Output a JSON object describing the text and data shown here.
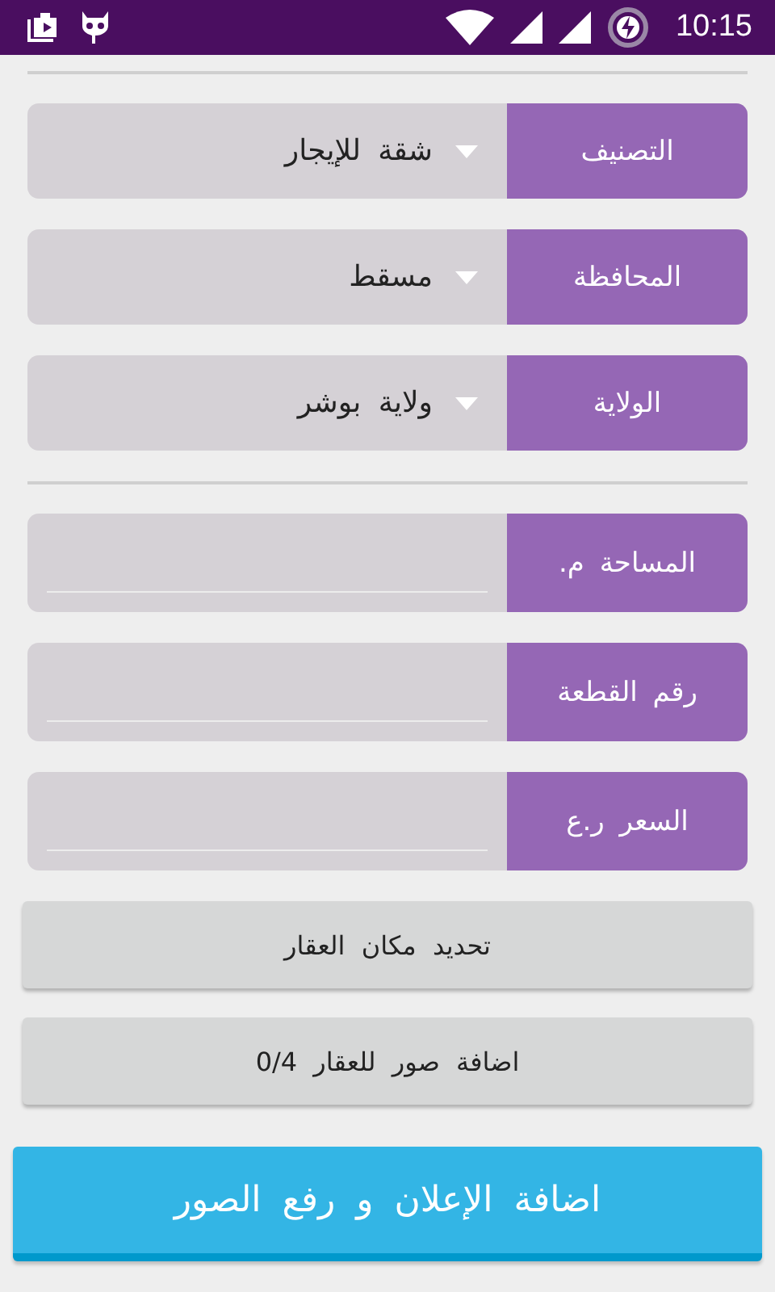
{
  "status_bar": {
    "time": "10:15"
  },
  "selects": [
    {
      "label": "التصنيف",
      "value": "شقة للإيجار"
    },
    {
      "label": "المحافظة",
      "value": "مسقط"
    },
    {
      "label": "الولاية",
      "value": "ولاية بوشر"
    }
  ],
  "inputs": [
    {
      "label": "المساحة م."
    },
    {
      "label": "رقم القطعة"
    },
    {
      "label": "السعر ر.ع"
    }
  ],
  "buttons": [
    {
      "label": "تحديد مكان العقار"
    },
    {
      "label": "اضافة صور للعقار 0/4"
    }
  ],
  "submit": {
    "label": "اضافة الإعلان و رفع الصور"
  }
}
